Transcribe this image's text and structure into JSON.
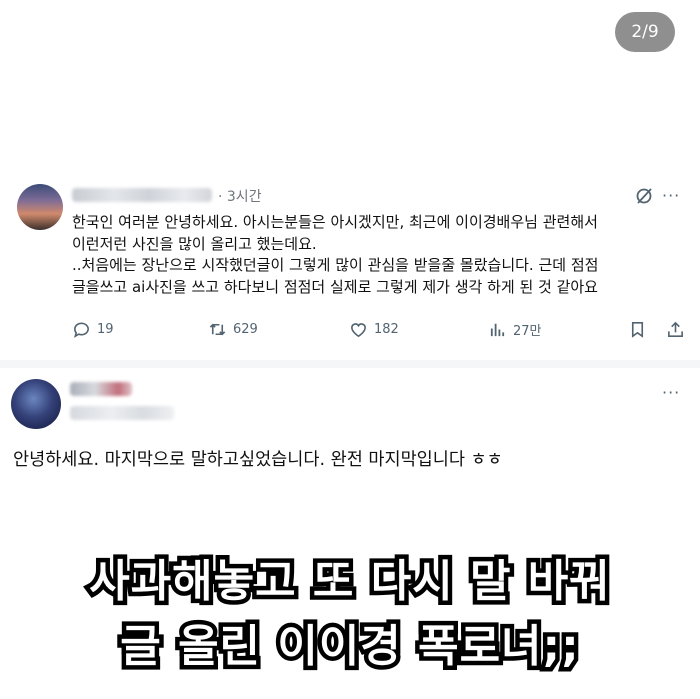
{
  "page_counter": "2/9",
  "post1": {
    "time": "· 3시간",
    "lines": [
      "한국인 여러분 안녕하세요. 아시는분들은 아시겠지만, 최근에 이이경배우님 관련해서",
      "이런저런 사진을 많이 올리고 했는데요.",
      "..처음에는 장난으로 시작했던글이 그렇게 많이 관심을 받을줄 몰랐습니다. 근데 점점",
      "글을쓰고 ai사진을 쓰고 하다보니 점점더 실제로 그렇게 제가 생각 하게 된 것 같아요"
    ],
    "stats": {
      "replies": "19",
      "reposts": "629",
      "likes": "182",
      "views": "27만"
    },
    "icons": [
      "grok-icon",
      "more-icon",
      "reply-icon",
      "repost-icon",
      "like-icon",
      "views-icon",
      "bookmark-icon",
      "share-icon"
    ]
  },
  "post2": {
    "text": "안녕하세요. 마지막으로 말하고싶었습니다. 완전 마지막입니다 ㅎㅎ"
  },
  "caption": {
    "line1": "사과해놓고 또 다시 말 바꿔",
    "line2": "글 올린 이이경 폭로녀;;"
  },
  "colors": {
    "text": "#0f1419",
    "muted": "#536471",
    "counter_bg": "#8f8f8f",
    "caption_fill": "#ffffff",
    "caption_stroke": "#000000"
  }
}
